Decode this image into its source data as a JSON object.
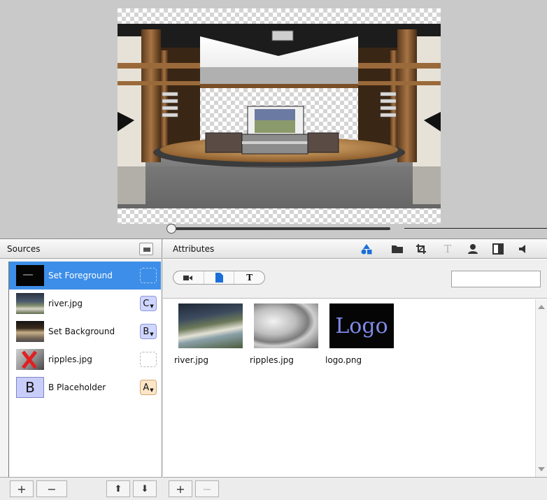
{
  "sources": {
    "title": "Sources",
    "items": [
      {
        "name": "Set Foreground",
        "badge": "",
        "badge_style": "empty",
        "selected": true,
        "thumb": "set-foreground"
      },
      {
        "name": "river.jpg",
        "badge": "C",
        "badge_style": "blue",
        "selected": false,
        "thumb": "river"
      },
      {
        "name": "Set Background",
        "badge": "B",
        "badge_style": "blue",
        "selected": false,
        "thumb": "set-background"
      },
      {
        "name": "ripples.jpg",
        "badge": "",
        "badge_style": "empty",
        "selected": false,
        "thumb": "ripples-missing"
      },
      {
        "name": "B Placeholder",
        "badge": "A",
        "badge_style": "peach",
        "selected": false,
        "thumb": "placeholder"
      }
    ],
    "placeholder_thumb_letter": "B",
    "footer": {
      "add": "+",
      "remove": "−",
      "move_up": "⬆",
      "move_down": "⬇"
    }
  },
  "attributes": {
    "title": "Attributes",
    "toolbar_icons": [
      "shapes-icon",
      "folder-icon",
      "crop-icon",
      "text-icon",
      "person-icon",
      "split-view-icon",
      "audio-icon"
    ],
    "segments": [
      "video-camera-icon",
      "document-icon",
      "T"
    ],
    "search_value": "",
    "files": [
      {
        "name": "river.jpg",
        "thumb": "river"
      },
      {
        "name": "ripples.jpg",
        "thumb": "ripples"
      },
      {
        "name": "logo.png",
        "thumb": "logo"
      }
    ],
    "logo_text": "Logo",
    "footer": {
      "add": "+",
      "remove": "−"
    }
  },
  "colors": {
    "selection": "#3d8ee8",
    "accent_blue": "#1a6fd8",
    "preview_bg": "#c9c9c9"
  },
  "scrubber": {
    "position": 0.0
  }
}
